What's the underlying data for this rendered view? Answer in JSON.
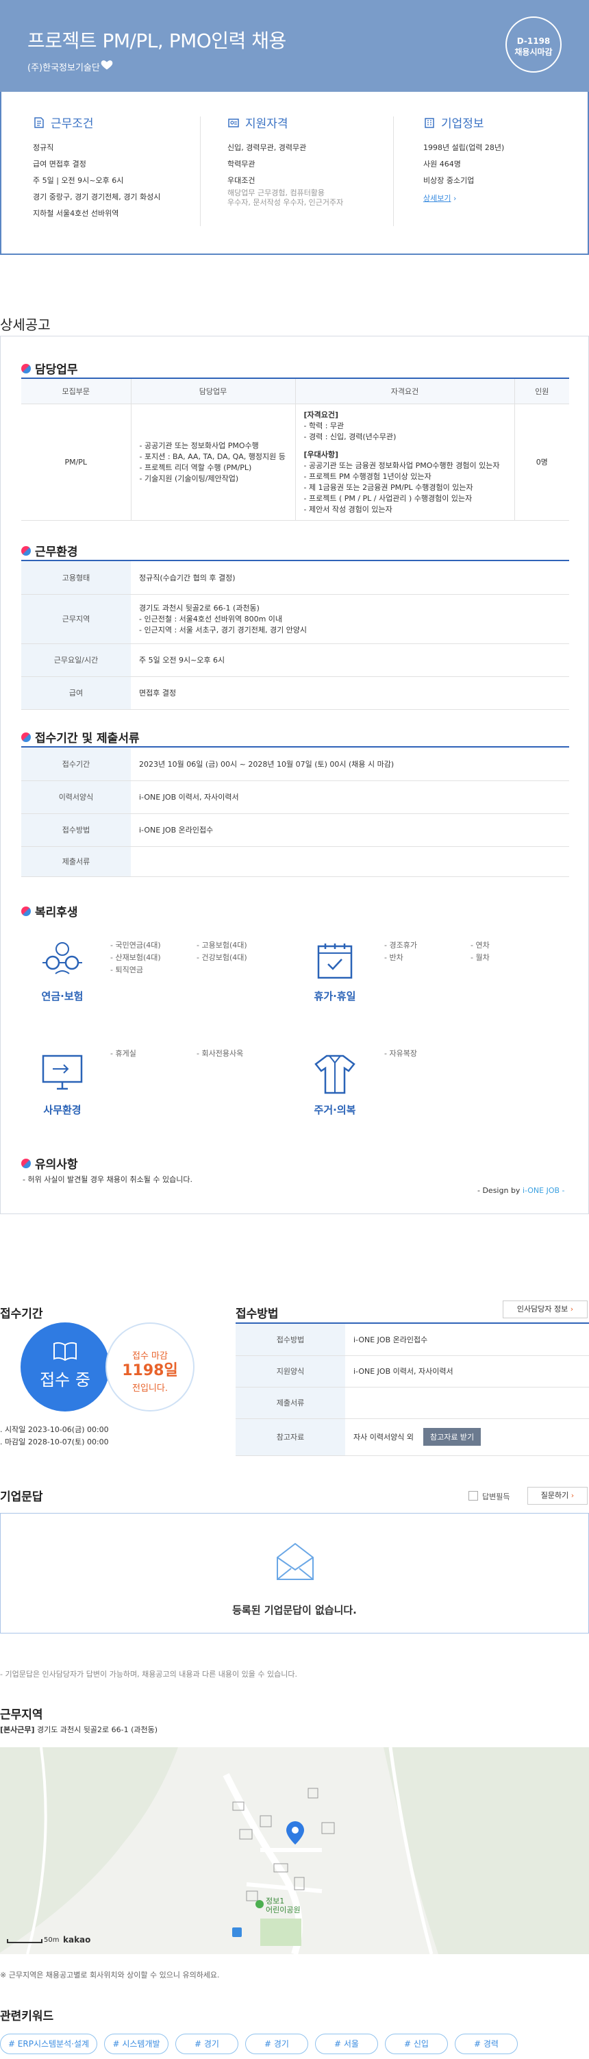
{
  "header": {
    "title": "프로젝트 PM/PL, PMO인력 채용",
    "company": "(주)한국정보기술단",
    "dday": "D-1198",
    "dday_sub": "채용시마감"
  },
  "summary": {
    "conditions": {
      "title": "근무조건",
      "items": [
        "정규직",
        "급여 면접후 결정",
        "주 5일 | 오전 9시~오후 6시",
        "경기 중랑구, 경기 경기전체, 경기 화성시",
        "지하철 서울4호선 선바위역"
      ]
    },
    "qualification": {
      "title": "지원자격",
      "items": [
        "신입, 경력무관, 경력무관",
        "학력무관",
        "우대조건"
      ],
      "gray": [
        "해당업무 근무경험, 컴퓨터활용",
        "우수자, 문서작성 우수자, 인근거주자"
      ]
    },
    "company": {
      "title": "기업정보",
      "items": [
        "1998년 설립(업력 28년)",
        "사원 464명",
        "비상장 중소기업"
      ],
      "link": "상세보기"
    }
  },
  "detail": {
    "title": "상세공고",
    "duty": {
      "heading": "담당업무",
      "columns": [
        "모집부문",
        "담당업무",
        "자격요건",
        "인원"
      ],
      "row": {
        "part": "PM/PL",
        "tasks": [
          "- 공공기관 또는 정보화사업 PMO수행",
          "- 포지션 : BA, AA, TA, DA, QA, 행정지원 등",
          "- 프로젝트 리더 역할 수행 (PM/PL)",
          "- 기술지원 (기술이팅/제안작업)"
        ],
        "qual_title": "[자격요건]",
        "qual": [
          "- 학력 : 무관",
          "- 경력 : 신입, 경력(년수무관)"
        ],
        "pref_title": "[우대사항]",
        "pref": [
          "- 공공기관 또는 금융권 정보화사업 PMO수행한 경험이 있는자",
          "- 프로젝트 PM 수행경험 1년이상 있는자",
          "- 제 1금융권 또는 2금융권 PM/PL 수행경험이 있는자",
          "- 프로젝트 ( PM / PL / 사업관리 ) 수행경험이 있는자",
          "- 제안서 작성 경험이 있는자"
        ],
        "count": "0명"
      }
    },
    "environment": {
      "heading": "근무환경",
      "rows": [
        {
          "label": "고용형태",
          "value": [
            "정규직(수습기간 협의 후 결정)"
          ]
        },
        {
          "label": "근무지역",
          "value": [
            "경기도 과천시 뒷골2로 66-1 (과천동)",
            "- 인근전철 : 서울4호선 선바위역 800m 이내",
            "- 인근지역 : 서울 서초구, 경기 경기전체, 경기 안양시"
          ]
        },
        {
          "label": "근무요일/시간",
          "value": [
            "주 5일 오전 9시~오후 6시"
          ]
        },
        {
          "label": "급여",
          "value": [
            "면접후 결정"
          ]
        }
      ]
    },
    "apply": {
      "heading": "접수기간 및 제출서류",
      "rows": [
        {
          "label": "접수기간",
          "value": "2023년 10월 06일 (금) 00시 ~ 2028년 10월 07일 (토) 00시 (채용 시 마감)"
        },
        {
          "label": "이력서양식",
          "value": "i-ONE JOB 이력서, 자사이력서"
        },
        {
          "label": "접수방법",
          "value": "i-ONE JOB 온라인접수"
        },
        {
          "label": "제출서류",
          "value": ""
        }
      ]
    },
    "welfare": {
      "heading": "복리후생",
      "groups": [
        {
          "name": "연금·보험",
          "icon": "glasses-icon",
          "items": [
            "- 국민연금(4대)",
            "- 고용보험(4대)",
            "- 산재보험(4대)",
            "- 건강보험(4대)",
            "- 퇴직연금"
          ]
        },
        {
          "name": "휴가·휴일",
          "icon": "calendar-icon",
          "items": [
            "- 경조휴가",
            "- 연차",
            "- 반차",
            "- 월차"
          ]
        },
        {
          "name": "사무환경",
          "icon": "monitor-icon",
          "items": [
            "- 휴게실",
            "- 회사전용사옥"
          ]
        },
        {
          "name": "주거·의복",
          "icon": "shirt-icon",
          "items": [
            "- 자유복장"
          ]
        }
      ]
    },
    "notice": {
      "heading": "유의사항",
      "text": "- 허위 사실이 발견될 경우 채용이 취소될 수 있습니다."
    },
    "design_by_prefix": "- Design by ",
    "design_by_brand": "i-ONE JOB -"
  },
  "period": {
    "title": "접수기간",
    "status": "접수 중",
    "deadline_label": "접수 마감",
    "deadline_days": "1198일",
    "deadline_suffix": "전입니다.",
    "start": "시작일 2023-10-06(금) 00:00",
    "end": "마감일 2028-10-07(토) 00:00"
  },
  "method": {
    "title": "접수방법",
    "contact_button": "인사담당자 정보",
    "rows": [
      {
        "label": "접수방법",
        "value": "i-ONE JOB 온라인접수"
      },
      {
        "label": "지원양식",
        "value": "i-ONE JOB 이력서, 자사이력서"
      },
      {
        "label": "제출서류",
        "value": ""
      },
      {
        "label": "참고자료",
        "value": "자사 이력서양식 외",
        "button": "참고자료 받기"
      }
    ]
  },
  "qa": {
    "title": "기업문답",
    "checkbox": "답변필득",
    "ask_button": "질문하기",
    "empty": "등록된 기업문답이 없습니다.",
    "note": "- 기업문답은 인사담당자가 답변이 가능하며, 채용공고의 내용과 다른 내용이 있을 수 있습니다."
  },
  "location": {
    "title": "근무지역",
    "tag": "[본사근무]",
    "address": "경기도 과천시 뒷골2로 66-1 (과천동)",
    "map_label": "정보1\n어린이공원",
    "scale": "50m",
    "map_brand": "kakao",
    "note": "※ 근무지역은 채용공고별로 회사위치와 상이할 수 있으니 유의하세요."
  },
  "keywords": {
    "title": "관련키워드",
    "items": [
      "# ERP시스템분석·설계",
      "# 시스템개발",
      "# 경기",
      "# 경기",
      "# 서울",
      "# 신입",
      "# 경력"
    ]
  },
  "colors": {
    "header": "#7a9cc9",
    "accent": "#2f7be2",
    "deadline": "#e8622a"
  }
}
